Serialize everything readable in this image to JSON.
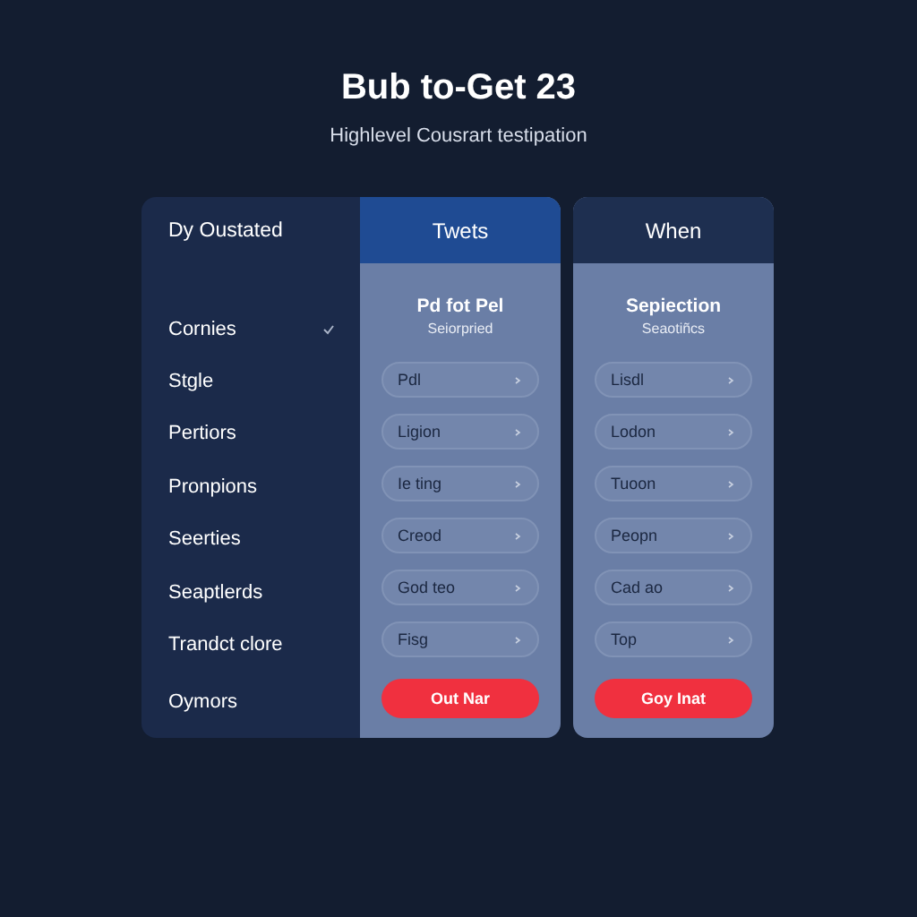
{
  "title": "Bub to-Get 23",
  "subtitle": "Highlevel Cousrart testipation",
  "features": {
    "heading": "Dy Oustated",
    "items": [
      {
        "label": "Cornies",
        "checked": true
      },
      {
        "label": "Stgle",
        "checked": false
      },
      {
        "label": "Pertiors",
        "checked": false
      },
      {
        "label": "Pronpions",
        "checked": false
      },
      {
        "label": "Seerties",
        "checked": false
      },
      {
        "label": "Seaptlerds",
        "checked": false
      },
      {
        "label": "Trandct clore",
        "checked": false
      },
      {
        "label": "Oymors",
        "checked": false
      }
    ]
  },
  "plans": [
    {
      "header": "Twets",
      "selected": true,
      "name": "Pd fot Pel",
      "note": "Seiorpried",
      "fields": [
        "Pdl",
        "Ligion",
        "Ie ting",
        "Creod",
        "God teo",
        "Fisg"
      ],
      "button": "Out Nar"
    },
    {
      "header": "When",
      "selected": false,
      "name": "Sepiection",
      "note": "Seaotiñcs",
      "fields": [
        "Lisdl",
        "Lodon",
        "Tuoon",
        "Peopn",
        "Cad ao",
        "Top"
      ],
      "button": "Goy Inat"
    }
  ]
}
